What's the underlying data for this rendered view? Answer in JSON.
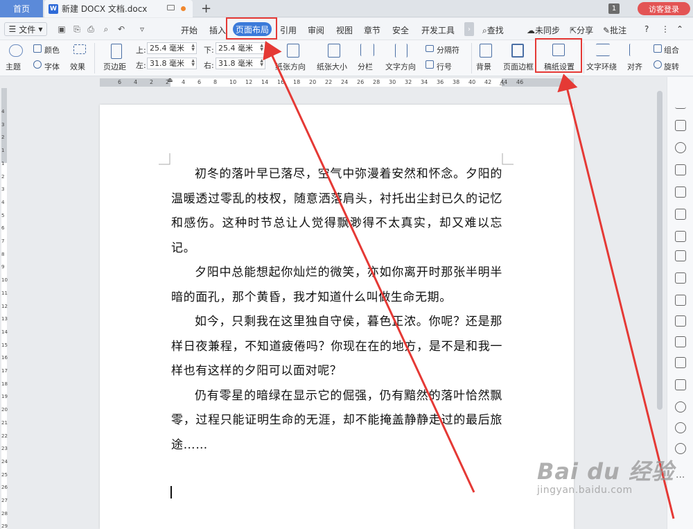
{
  "tabs": {
    "home": "首页",
    "doc_title": "新建 DOCX 文档.docx",
    "window_count": "1",
    "visitor": "访客登录"
  },
  "menu": {
    "file": "文件",
    "items": [
      "开始",
      "插入",
      "页面布局",
      "引用",
      "审阅",
      "视图",
      "章节",
      "安全",
      "开发工具"
    ],
    "active": "页面布局",
    "search": "查找",
    "sync": "未同步",
    "share": "分享",
    "comment": "批注"
  },
  "ribbon": {
    "color": "颜色",
    "theme": "主题",
    "font": "字体",
    "effects": "效果",
    "margins": "页边距",
    "top_label": "上:",
    "top_value": "25.4 毫米",
    "bottom_label": "下:",
    "bottom_value": "25.4 毫米",
    "left_label": "左:",
    "left_value": "31.8 毫米",
    "right_label": "右:",
    "right_value": "31.8 毫米",
    "orientation": "纸张方向",
    "size": "纸张大小",
    "columns": "分栏",
    "text_direction": "文字方向",
    "separator": "分隔符",
    "line_number": "行号",
    "background": "背景",
    "page_border": "页面边框",
    "manuscript": "稿纸设置",
    "text_wrap": "文字环绕",
    "align": "对齐",
    "group": "组合",
    "rotate": "旋转"
  },
  "ruler": {
    "top_numbers": [
      "6",
      "4",
      "2",
      "2",
      "4",
      "6",
      "8",
      "10",
      "12",
      "14",
      "16",
      "18",
      "20",
      "22",
      "24",
      "26",
      "28",
      "30",
      "32",
      "34",
      "36",
      "38",
      "40",
      "42",
      "44",
      "46"
    ],
    "left_numbers": [
      "4",
      "3",
      "2",
      "1",
      "1",
      "2",
      "3",
      "4",
      "5",
      "6",
      "7",
      "8",
      "9",
      "10",
      "11",
      "12",
      "13",
      "14",
      "15",
      "16",
      "17",
      "18",
      "19",
      "20",
      "21",
      "22",
      "23",
      "24",
      "25",
      "26",
      "27",
      "28",
      "29"
    ]
  },
  "document": {
    "paragraphs": [
      "初冬的落叶早已落尽，空气中弥漫着安然和怀念。夕阳的温暖透过零乱的枝杈，随意洒落肩头，衬托出尘封已久的记忆和感伤。这种时节总让人觉得飘渺得不太真实，却又难以忘记。",
      "夕阳中总能想起你灿烂的微笑，亦如你离开时那张半明半暗的面孔，那个黄昏，我才知道什么叫做生命无期。",
      "如今，只剩我在这里独自守侯，暮色正浓。你呢？还是那样日夜兼程，不知道疲倦吗？你现在在的地方，是不是和我一样也有这样的夕阳可以面对呢？",
      "仍有零星的暗绿在显示它的倔强，仍有黯然的落叶恰然飘零，过程只能证明生命的无涯，却不能掩盖静静走过的最后旅途……"
    ]
  },
  "watermark": {
    "main": "Bai du 经验",
    "sub": "jingyan.baidu.com"
  },
  "colors": {
    "accent": "#3b7ad9",
    "highlight": "#e53935",
    "visitor": "#e35454"
  }
}
